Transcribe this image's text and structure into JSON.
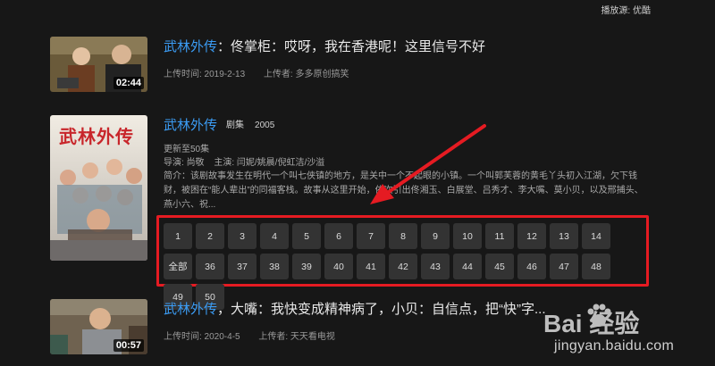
{
  "source": "播放源: 优酷",
  "videos": [
    {
      "brand": "武林外传",
      "title_rest": "：佟掌柜：哎呀，我在香港呢！这里信号不好",
      "duration": "02:44",
      "upload_time": "上传时间: 2019-2-13",
      "uploader": "上传者: 多多原创搞笑"
    },
    {
      "brand": "武林外传",
      "title_rest": "，大嘴：我快变成精神病了，小贝：自信点，把“快”字...",
      "duration": "00:57",
      "upload_time": "上传时间: 2020-4-5",
      "uploader": "上传者: 天天看电视"
    }
  ],
  "show": {
    "title": "武林外传",
    "poster_text": "武林外传",
    "tag": "剧集",
    "year": "2005",
    "updated": "更新至50集",
    "director_label": "导演:",
    "director": "尚敬",
    "cast_label": "主演:",
    "cast": "闫妮/姚晨/倪虹洁/沙溢",
    "desc": "简介：该剧故事发生在明代一个叫七侠镇的地方，是关中一个不起眼的小镇。一个叫郭芙蓉的黄毛丫头初入江湖，欠下钱财，被困在“能人辈出”的同福客栈。故事从这里开始，依次引出佟湘玉、白展堂、吕秀才、李大嘴、莫小贝，以及邢捕头、燕小六、祝..."
  },
  "episodes": [
    {
      "label": "1"
    },
    {
      "label": "2"
    },
    {
      "label": "3"
    },
    {
      "label": "4"
    },
    {
      "label": "5"
    },
    {
      "label": "6"
    },
    {
      "label": "7"
    },
    {
      "label": "8"
    },
    {
      "label": "9"
    },
    {
      "label": "10"
    },
    {
      "label": "11"
    },
    {
      "label": "12"
    },
    {
      "label": "13"
    },
    {
      "label": "14"
    },
    {
      "label": "全部"
    },
    {
      "label": "36"
    },
    {
      "label": "37"
    },
    {
      "label": "38"
    },
    {
      "label": "39"
    },
    {
      "label": "40"
    },
    {
      "label": "41"
    },
    {
      "label": "42"
    },
    {
      "label": "43"
    },
    {
      "label": "44"
    },
    {
      "label": "45"
    },
    {
      "label": "46"
    },
    {
      "label": "47"
    },
    {
      "label": "48"
    },
    {
      "label": "49"
    },
    {
      "label": "50"
    }
  ],
  "watermark": {
    "logo": "Bai 经验",
    "url": "jingyan.baidu.com"
  },
  "colors": {
    "brand_blue": "#3b9cf4",
    "highlight_red": "#e51b22",
    "button_bg": "#333333"
  }
}
